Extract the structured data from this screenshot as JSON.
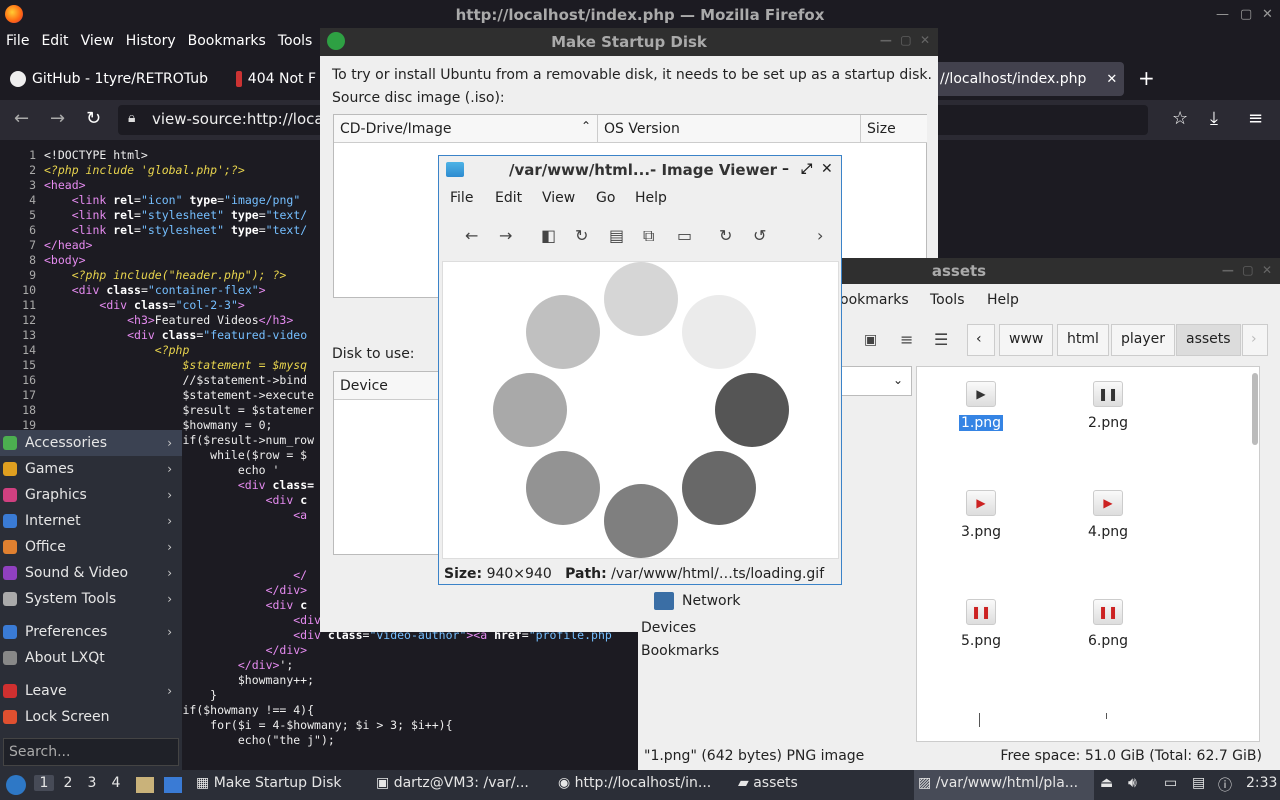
{
  "firefox": {
    "title": "http://localhost/index.php — Mozilla Firefox",
    "menu": [
      "File",
      "Edit",
      "View",
      "History",
      "Bookmarks",
      "Tools",
      "H"
    ],
    "tabs": [
      {
        "label": "GitHub - 1tyre/RETROTub"
      },
      {
        "label": "404 Not F"
      },
      {
        "label": "//localhost/index.php",
        "close": "✕"
      }
    ],
    "new_tab": "+",
    "url": "view-source:http://locall"
  },
  "source_lines": [
    {
      "n": "1",
      "html": "<span class='plain'>&lt;!DOCTYPE html&gt;</span>"
    },
    {
      "n": "2",
      "html": "<span class='php'>&lt;?php include 'global.php';?&gt;</span>"
    },
    {
      "n": "3",
      "html": "<span class='tag'>&lt;head&gt;</span>"
    },
    {
      "n": "4",
      "html": "    <span class='tag'>&lt;link </span><span class='attr'>rel</span>=<span class='str'>\"icon\"</span> <span class='attr'>type</span>=<span class='str'>\"image/png\"</span>"
    },
    {
      "n": "5",
      "html": "    <span class='tag'>&lt;link </span><span class='attr'>rel</span>=<span class='str'>\"stylesheet\"</span> <span class='attr'>type</span>=<span class='str'>\"text/</span>"
    },
    {
      "n": "6",
      "html": "    <span class='tag'>&lt;link </span><span class='attr'>rel</span>=<span class='str'>\"stylesheet\"</span> <span class='attr'>type</span>=<span class='str'>\"text/</span>"
    },
    {
      "n": "7",
      "html": "<span class='tag'>&lt;/head&gt;</span>"
    },
    {
      "n": "8",
      "html": "<span class='tag'>&lt;body&gt;</span>"
    },
    {
      "n": "9",
      "html": "    <span class='php'>&lt;?php include(\"header.php\"); ?&gt;</span>"
    },
    {
      "n": "10",
      "html": "    <span class='tag'>&lt;div </span><span class='attr'>class</span>=<span class='str'>\"container-flex\"</span><span class='tag'>&gt;</span>"
    },
    {
      "n": "11",
      "html": "        <span class='tag'>&lt;div </span><span class='attr'>class</span>=<span class='str'>\"col-2-3\"</span><span class='tag'>&gt;</span>"
    },
    {
      "n": "12",
      "html": "            <span class='tag'>&lt;h3&gt;</span>Featured Videos<span class='tag'>&lt;/h3&gt;</span>"
    },
    {
      "n": "13",
      "html": "            <span class='tag'>&lt;div </span><span class='attr'>class</span>=<span class='str'>\"featured-video</span>"
    },
    {
      "n": "14",
      "html": "                <span class='php'>&lt;?php</span>"
    },
    {
      "n": "15",
      "html": "                    <span class='php'>$statement = $mysq</span>"
    },
    {
      "n": "16",
      "html": "                    //$statement-&gt;bind"
    },
    {
      "n": "17",
      "html": "                    $statement-&gt;execute"
    },
    {
      "n": "18",
      "html": "                    $result = $statemer"
    },
    {
      "n": "19",
      "html": "                    $howmany = 0;"
    },
    {
      "n": "",
      "html": "                    if($result-&gt;num_row"
    },
    {
      "n": "",
      "html": "                        while($row = $"
    },
    {
      "n": "",
      "html": "                            echo '"
    },
    {
      "n": "",
      "html": "                            <span class='tag'>&lt;div </span><span class='attr'>class=</span>"
    },
    {
      "n": "",
      "html": "                                <span class='tag'>&lt;div </span><span class='attr'>c</span>"
    },
    {
      "n": "",
      "html": "                                    <span class='tag'>&lt;a</span>"
    },
    {
      "n": "",
      "html": ""
    },
    {
      "n": "",
      "html": ""
    },
    {
      "n": "",
      "html": ""
    },
    {
      "n": "",
      "html": "                                    <span class='tag'>&lt;/</span>"
    },
    {
      "n": "",
      "html": "                                <span class='tag'>&lt;/div&gt;</span>"
    },
    {
      "n": "",
      "html": "                                <span class='tag'>&lt;div </span><span class='attr'>c</span>"
    },
    {
      "n": "",
      "html": "                                    <span class='tag'>&lt;div </span><span class='attr'>class</span>=<span class='str'>\"video-title\"</span><span class='tag'>&gt;&lt;a </span><span class='attr'>href</span>=<span class='str'>\"viewvideo.ph</span>"
    },
    {
      "n": "",
      "html": "                                    <span class='tag'>&lt;div </span><span class='attr'>class</span>=<span class='str'>\"video-author\"</span><span class='tag'>&gt;&lt;a </span><span class='attr'>href</span>=<span class='str'>\"profile.php</span>"
    },
    {
      "n": "",
      "html": "                                <span class='tag'>&lt;/div&gt;</span>"
    },
    {
      "n": "",
      "html": "                            <span class='tag'>&lt;/div&gt;</span>';"
    },
    {
      "n": "",
      "html": "                            $howmany++;"
    },
    {
      "n": "",
      "html": "                        }"
    },
    {
      "n": "",
      "html": "                    if($howmany !== 4){"
    },
    {
      "n": "",
      "html": "                        for($i = 4-$howmany; $i &gt; 3; $i++){"
    },
    {
      "n": "",
      "html": "                            echo(\"the j\");"
    }
  ],
  "lxqt_menu": {
    "items": [
      {
        "label": "Accessories",
        "icon": "accessories-icon",
        "color": "#4caf50"
      },
      {
        "label": "Games",
        "icon": "games-icon",
        "color": "#e0a020"
      },
      {
        "label": "Graphics",
        "icon": "graphics-icon",
        "color": "#d04080"
      },
      {
        "label": "Internet",
        "icon": "internet-icon",
        "color": "#3a7bd5"
      },
      {
        "label": "Office",
        "icon": "office-icon",
        "color": "#e08030"
      },
      {
        "label": "Sound & Video",
        "icon": "sound-video-icon",
        "color": "#9040c0"
      },
      {
        "label": "System Tools",
        "icon": "system-tools-icon",
        "color": "#aaaaaa"
      },
      {
        "label": "Preferences",
        "icon": "preferences-icon",
        "color": "#3a7bd5"
      },
      {
        "label": "About LXQt",
        "icon": "about-icon",
        "color": "#888888"
      },
      {
        "label": "Leave",
        "icon": "leave-icon",
        "color": "#d03030"
      },
      {
        "label": "Lock Screen",
        "icon": "lock-icon",
        "color": "#e05030"
      }
    ],
    "search_placeholder": "Search..."
  },
  "startup_disk": {
    "title": "Make Startup Disk",
    "intro": "To try or install Ubuntu from a removable disk, it needs to be set up as a startup disk.",
    "source_label": "Source disc image (.iso):",
    "columns": [
      "CD-Drive/Image",
      "OS Version",
      "Size"
    ],
    "disk_label": "Disk to use:",
    "device_column": "Device"
  },
  "image_viewer": {
    "title": "/var/www/html...- Image Viewer",
    "menu": [
      "File",
      "Edit",
      "View",
      "Go",
      "Help"
    ],
    "size_label": "Size:",
    "size_value": "940×940",
    "path_label": "Path:",
    "path_value": "/var/www/html/…ts/loading.gif",
    "dots": [
      "#d6d6d6",
      "#ebebeb",
      "#555555",
      "#686868",
      "#7f7f7f",
      "#939393",
      "#a9a9a9",
      "#c0c0c0"
    ]
  },
  "file_manager": {
    "title": "assets",
    "menu": [
      "ookmarks",
      "Tools",
      "Help"
    ],
    "breadcrumbs": [
      "www",
      "html",
      "player",
      "assets"
    ],
    "places": {
      "network": "Network",
      "devices": "Devices",
      "bookmarks": "Bookmarks"
    },
    "files": [
      {
        "name": "1.png",
        "glyph": "▶",
        "color": "#333333"
      },
      {
        "name": "2.png",
        "glyph": "❚❚",
        "color": "#333333"
      },
      {
        "name": "3.png",
        "glyph": "▶",
        "color": "#cc2222"
      },
      {
        "name": "4.png",
        "glyph": "▶",
        "color": "#cc2222"
      },
      {
        "name": "5.png",
        "glyph": "❚❚",
        "color": "#cc2222"
      },
      {
        "name": "6.png",
        "glyph": "❚❚",
        "color": "#cc2222"
      }
    ],
    "status_left": "\"1.png\" (642 bytes) PNG image",
    "status_right": "Free space: 51.0 GiB (Total: 62.7 GiB)"
  },
  "taskbar": {
    "workspaces": [
      "1",
      "2",
      "3",
      "4"
    ],
    "windows": [
      "Make Startup Disk",
      "dartz@VM3: /var/...",
      "http://localhost/in...",
      "assets",
      "/var/www/html/pla..."
    ],
    "clock": "2:33"
  }
}
